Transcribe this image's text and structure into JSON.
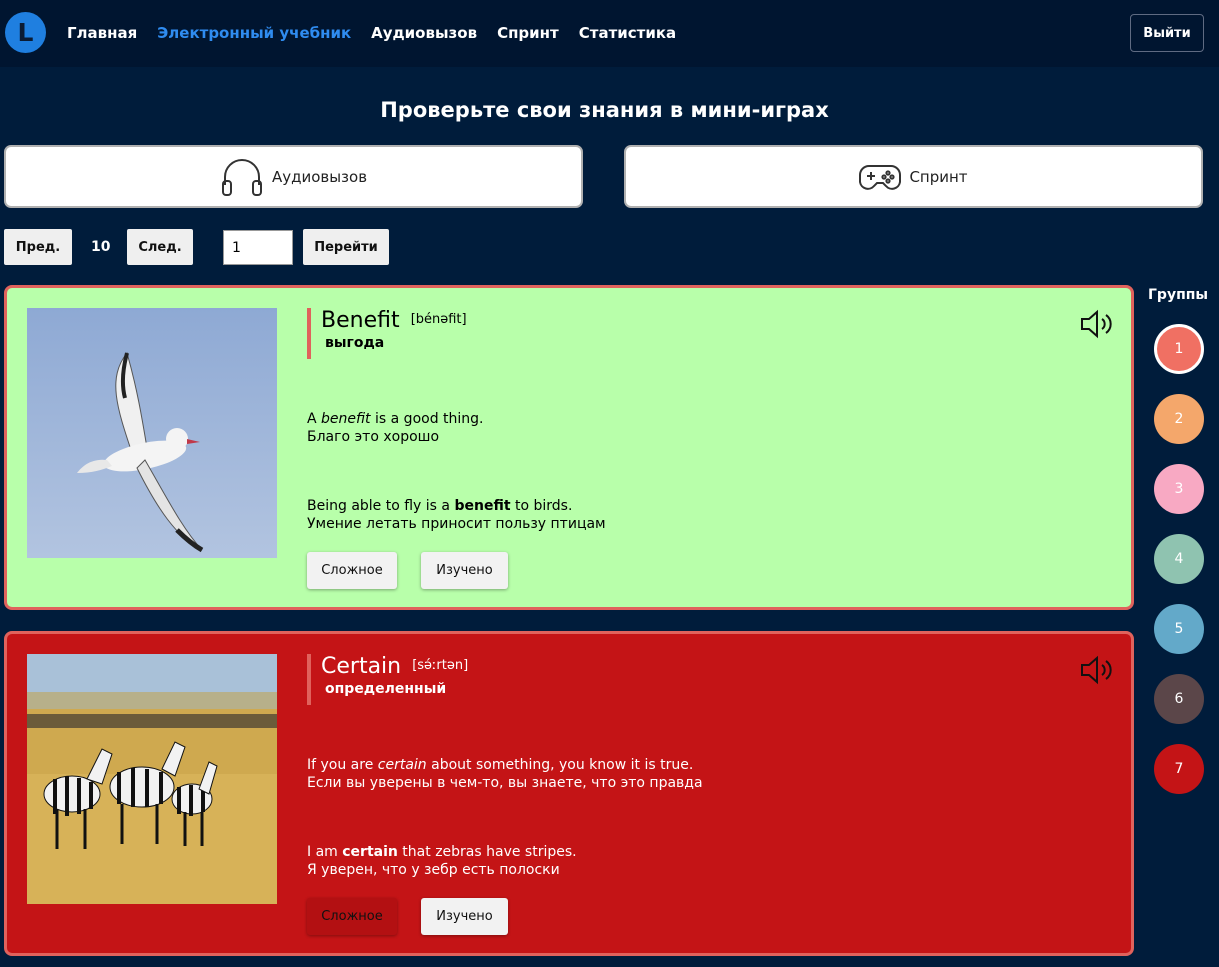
{
  "header": {
    "logo_letter": "L",
    "nav": [
      {
        "label": "Главная",
        "active": false
      },
      {
        "label": "Электронный учебник",
        "active": true
      },
      {
        "label": "Аудиовызов",
        "active": false
      },
      {
        "label": "Спринт",
        "active": false
      },
      {
        "label": "Статистика",
        "active": false
      }
    ],
    "logout_label": "Выйти"
  },
  "page_title": "Проверьте свои знания в мини-играх",
  "games": {
    "audio": {
      "label": "Аудиовызов",
      "icon": "headphones-icon"
    },
    "sprint": {
      "label": "Спринт",
      "icon": "gamepad-icon"
    }
  },
  "pager": {
    "prev_label": "Пред.",
    "page_number": "10",
    "next_label": "След.",
    "input_value": "1",
    "go_label": "Перейти"
  },
  "cards": [
    {
      "word": "Benefit",
      "transcription": "[bénəfit]",
      "translation": "выгода",
      "meaning_before": "A ",
      "meaning_word": "benefit",
      "meaning_after": " is a good thing.",
      "meaning_translation": "Благо это хорошо",
      "example_before": "Being able to fly is a ",
      "example_word": "benefit",
      "example_after": " to birds.",
      "example_translation": "Умение летать приносит пользу птицам",
      "hard_label": "Сложное",
      "learned_label": "Изучено",
      "background": "#b8ffaa"
    },
    {
      "word": "Certain",
      "transcription": "[sə́ːrtən]",
      "translation": "определенный",
      "meaning_before": "If you are ",
      "meaning_word": "certain",
      "meaning_after": " about something, you know it is true.",
      "meaning_translation": "Если вы уверены в чем-то, вы знаете, что это правда",
      "example_before": "I am ",
      "example_word": "certain",
      "example_after": " that zebras have stripes.",
      "example_translation": "Я уверен, что у зебр есть полоски",
      "hard_label": "Сложное",
      "learned_label": "Изучено",
      "background": "#c41416"
    }
  ],
  "groups": {
    "title": "Группы",
    "items": [
      {
        "label": "1",
        "color": "#f07063",
        "active": true
      },
      {
        "label": "2",
        "color": "#f4a76b",
        "active": false
      },
      {
        "label": "3",
        "color": "#f8a9c3",
        "active": false
      },
      {
        "label": "4",
        "color": "#8fc3b0",
        "active": false
      },
      {
        "label": "5",
        "color": "#63a9c9",
        "active": false
      },
      {
        "label": "6",
        "color": "#5b4649",
        "active": false
      },
      {
        "label": "7",
        "color": "#c41416",
        "active": false
      }
    ]
  }
}
